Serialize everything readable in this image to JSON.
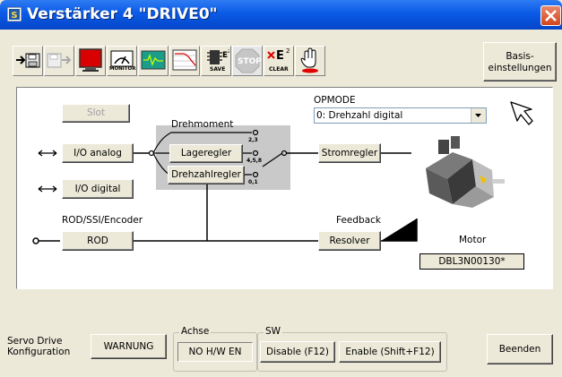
{
  "window": {
    "title": "Verstärker 4 \"DRIVE0\"",
    "title_color": "#0a5ae6",
    "close_color": "#d2461c"
  },
  "toolbar": {
    "monitor_label": "MONITOR",
    "save_label": "SAVE",
    "stop_label": "STOP",
    "clear_label": "CLEAR",
    "e2_label": "E",
    "e2_sup": "2",
    "basis_line1": "Basis-",
    "basis_line2": "einstellungen"
  },
  "diagram": {
    "slot_label": "Slot",
    "io_analog_label": "I/O analog",
    "io_digital_label": "I/O digital",
    "rod_ssi_label": "ROD/SSI/Encoder",
    "rod_label": "ROD",
    "drehmoment_label": "Drehmoment",
    "lageregler_label": "Lageregler",
    "drehzahlregler_label": "Drehzahlregler",
    "opmode_label": "OPMODE",
    "opmode_value": "0: Drehzahl digital",
    "stromregler_label": "Stromregler",
    "feedback_label": "Feedback",
    "resolver_label": "Resolver",
    "motor_label": "Motor",
    "motor_value": "DBL3N00130*",
    "switch_pos_1": "2,3",
    "switch_pos_2": "4,5,8",
    "switch_pos_3": "0,1"
  },
  "bottom": {
    "servo_line1": "Servo Drive",
    "servo_line2": "Konfiguration",
    "warnung_label": "WARNUNG",
    "achse_title": "Achse",
    "achse_value": "NO H/W EN",
    "sw_title": "SW",
    "disable_label": "Disable (F12)",
    "enable_label": "Enable (Shift+F12)",
    "beenden_label": "Beenden"
  }
}
